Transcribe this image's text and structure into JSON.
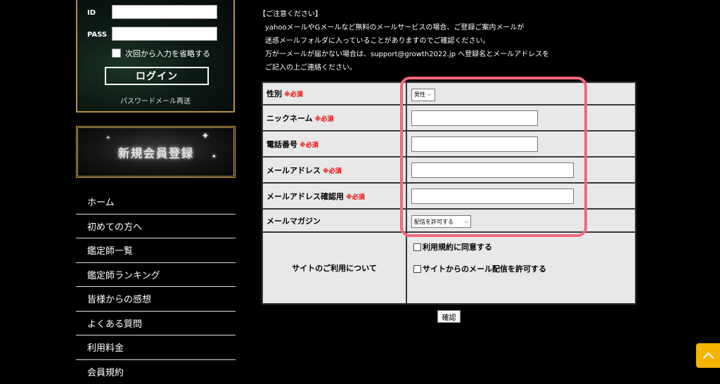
{
  "login": {
    "id_label": "ID",
    "pass_label": "PASS",
    "remember_label": "次回から入力を省略する",
    "login_button": "ログイン",
    "password_reset": "パスワードメール再送"
  },
  "register_banner": "新規会員登録",
  "nav": [
    "ホーム",
    "初めての方へ",
    "鑑定師一覧",
    "鑑定師ランキング",
    "皆様からの感想",
    "よくある質問",
    "利用料金",
    "会員規約"
  ],
  "notice": {
    "heading": "【ご注意ください】",
    "lines": [
      "yahooメールやGメールなど無料のメールサービスの場合、ご登録ご案内メールが",
      "迷惑メールフォルダに入っていることがありますのでご確認ください。",
      "万が一メールが届かない場合は、support@growth2022.jp へ登録名とメールアドレスを",
      "ご記入の上ご連絡ください。"
    ]
  },
  "form": {
    "required_mark": "※必須",
    "gender_label": "性別",
    "gender_value": "男性",
    "nickname_label": "ニックネーム",
    "phone_label": "電話番号",
    "email_label": "メールアドレス",
    "email_confirm_label": "メールアドレス確認用",
    "magazine_label": "メールマガジン",
    "magazine_value": "配信を許可する",
    "site_usage_label": "サイトのご利用について",
    "agree_terms": "利用規約に同意する",
    "agree_mail": "サイトからのメール配信を許可する"
  },
  "confirm_button": "確認",
  "colors": {
    "highlight": "#f06a78",
    "required": "#e00000",
    "scroll_top": "#f5b400",
    "gold_border": "#b8913c"
  }
}
